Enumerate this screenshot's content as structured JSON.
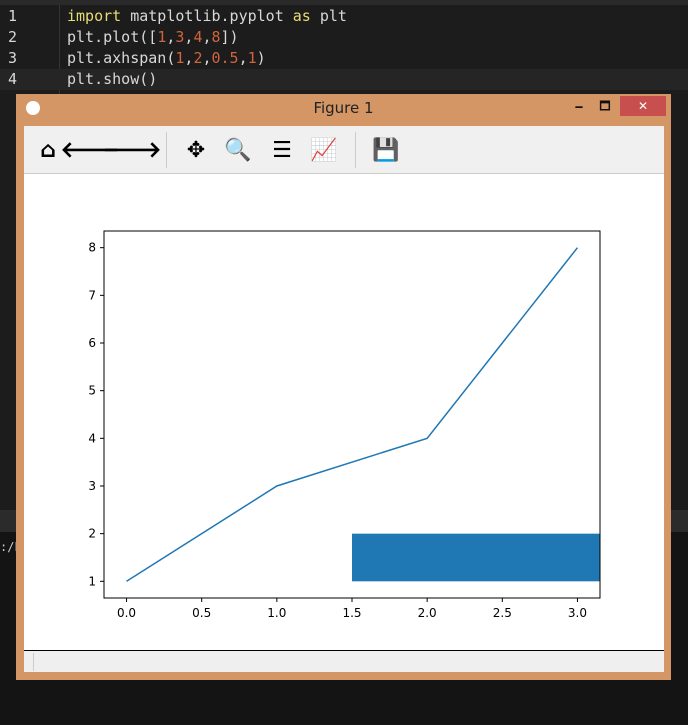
{
  "editor": {
    "lines": [
      {
        "num": "1",
        "tokens": [
          {
            "t": "import",
            "c": "kw"
          },
          {
            "t": " matplotlib.pyplot ",
            "c": ""
          },
          {
            "t": "as",
            "c": "kw"
          },
          {
            "t": " plt",
            "c": ""
          }
        ]
      },
      {
        "num": "2",
        "tokens": [
          {
            "t": "plt.plot([",
            "c": ""
          },
          {
            "t": "1",
            "c": "n"
          },
          {
            "t": ",",
            "c": ""
          },
          {
            "t": "3",
            "c": "n"
          },
          {
            "t": ",",
            "c": ""
          },
          {
            "t": "4",
            "c": "n"
          },
          {
            "t": ",",
            "c": ""
          },
          {
            "t": "8",
            "c": "n"
          },
          {
            "t": "])",
            "c": ""
          }
        ]
      },
      {
        "num": "3",
        "tokens": [
          {
            "t": "plt.axhspan(",
            "c": ""
          },
          {
            "t": "1",
            "c": "n"
          },
          {
            "t": ",",
            "c": ""
          },
          {
            "t": "2",
            "c": "n"
          },
          {
            "t": ",",
            "c": ""
          },
          {
            "t": "0.5",
            "c": "n"
          },
          {
            "t": ",",
            "c": ""
          },
          {
            "t": "1",
            "c": "n"
          },
          {
            "t": ")",
            "c": ""
          }
        ]
      },
      {
        "num": "4",
        "tokens": [
          {
            "t": "plt.show()",
            "c": ""
          }
        ]
      }
    ]
  },
  "console": {
    "text": ":/P"
  },
  "window": {
    "title": "Figure 1",
    "minimize": "🗕",
    "maximize": "🗖",
    "close": "✕"
  },
  "toolbar": [
    {
      "name": "home-icon",
      "glyph": "⌂"
    },
    {
      "name": "back-icon",
      "glyph": "🡐"
    },
    {
      "name": "forward-icon",
      "glyph": "🡒"
    },
    {
      "name": "pan-icon",
      "glyph": "✥"
    },
    {
      "name": "zoom-icon",
      "glyph": "🔍"
    },
    {
      "name": "subplots-icon",
      "glyph": "☰"
    },
    {
      "name": "edit-curves-icon",
      "glyph": "📈"
    },
    {
      "name": "save-icon",
      "glyph": "💾"
    }
  ],
  "chart_data": {
    "type": "line",
    "series": [
      {
        "x": [
          0,
          1,
          2,
          3
        ],
        "y": [
          1,
          3,
          4,
          8
        ],
        "color": "#1f77b4"
      }
    ],
    "axhspan": {
      "ymin": 1,
      "ymax": 2,
      "xmin_frac": 0.5,
      "xmax_frac": 1,
      "color": "#1f77b4"
    },
    "xlim": [
      -0.15,
      3.15
    ],
    "ylim": [
      0.65,
      8.35
    ],
    "xticks": [
      "0.0",
      "0.5",
      "1.0",
      "1.5",
      "2.0",
      "2.5",
      "3.0"
    ],
    "yticks": [
      "1",
      "2",
      "3",
      "4",
      "5",
      "6",
      "7",
      "8"
    ],
    "grid": false
  }
}
